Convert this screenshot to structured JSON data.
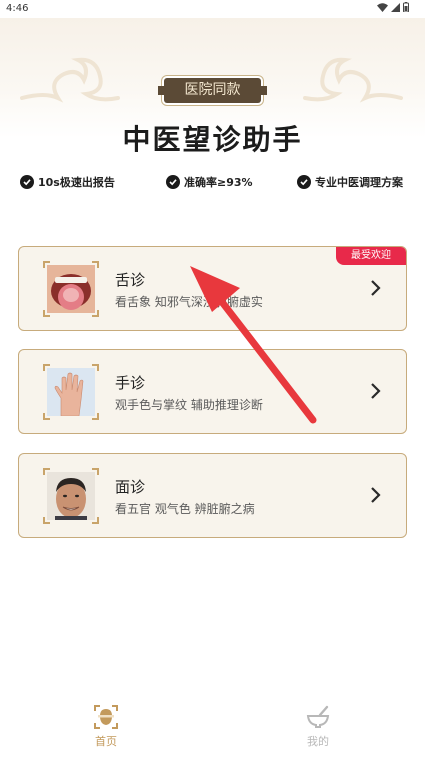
{
  "status_bar": {
    "time": "4:46"
  },
  "header": {
    "badge": "医院同款",
    "title": "中医望诊助手"
  },
  "features": [
    {
      "label": "10s极速出报告"
    },
    {
      "label": "准确率≥93%"
    },
    {
      "label": "专业中医调理方案"
    }
  ],
  "cards": [
    {
      "title": "舌诊",
      "desc": "看舌象 知邪气深浅肺腑虚实",
      "badge": "最受欢迎",
      "icon": "tongue-photo"
    },
    {
      "title": "手诊",
      "desc": "观手色与掌纹 辅助推理诊断",
      "icon": "hand-photo"
    },
    {
      "title": "面诊",
      "desc": "看五官 观气色 辨脏腑之病",
      "icon": "face-photo"
    }
  ],
  "tabs": [
    {
      "label": "首页",
      "active": true,
      "icon": "scan-face-icon"
    },
    {
      "label": "我的",
      "active": false,
      "icon": "mortar-icon"
    }
  ],
  "colors": {
    "accent_gold": "#c39a5c",
    "badge_brown": "#5b4a36",
    "card_border": "#c7ab7c",
    "card_bg": "#f8f4ec",
    "hot_red": "#e8294a",
    "annotation_arrow": "#e8383d"
  }
}
